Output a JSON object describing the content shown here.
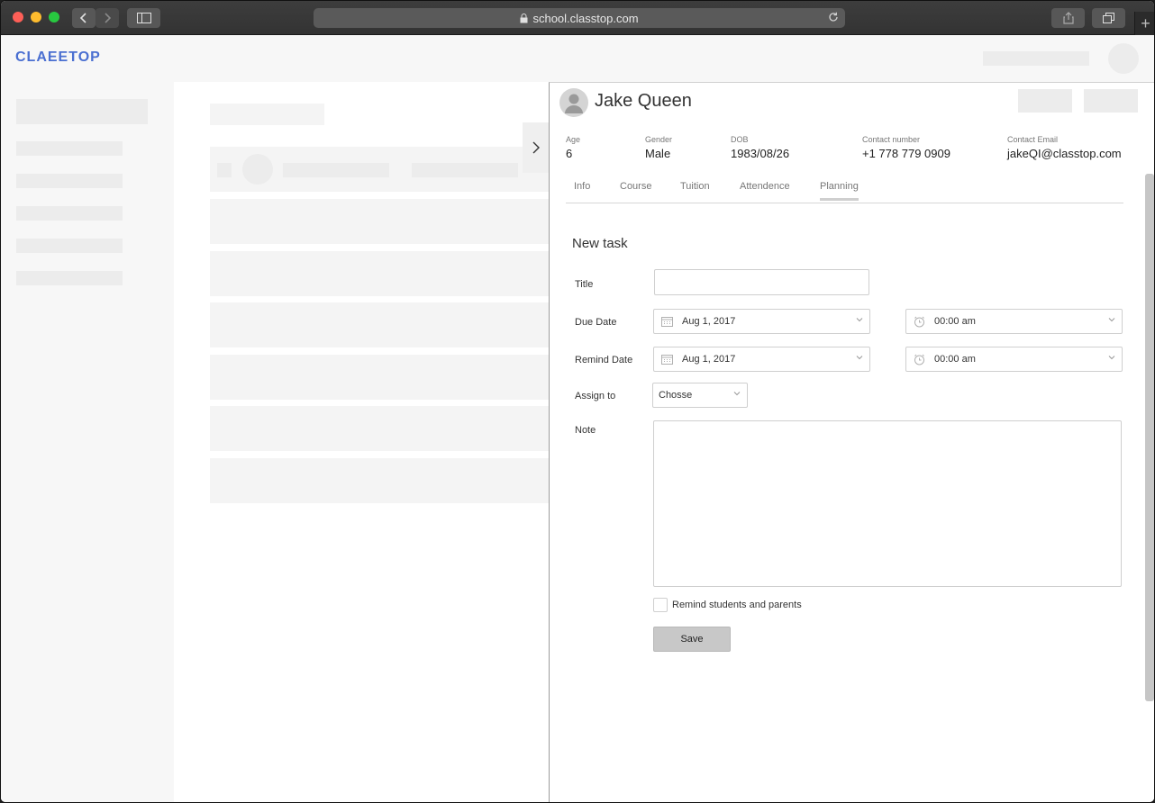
{
  "browser": {
    "url": "school.classtop.com"
  },
  "app": {
    "logo": "CLAEETOP"
  },
  "student": {
    "name": "Jake Queen",
    "fields": [
      {
        "label": "Age",
        "value": "6"
      },
      {
        "label": "Gender",
        "value": "Male"
      },
      {
        "label": "DOB",
        "value": "1983/08/26"
      },
      {
        "label": "Contact number",
        "value": "+1 778 779 0909"
      },
      {
        "label": "Contact Email",
        "value": "jakeQI@classtop.com"
      }
    ]
  },
  "tabs": [
    {
      "label": "Info",
      "active": false
    },
    {
      "label": "Course",
      "active": false
    },
    {
      "label": "Tuition",
      "active": false
    },
    {
      "label": "Attendence",
      "active": false
    },
    {
      "label": "Planning",
      "active": true
    }
  ],
  "form": {
    "title": "New task",
    "title_label": "Title",
    "title_value": "",
    "due_label": "Due Date",
    "due_date": "Aug 1, 2017",
    "due_time": "00:00 am",
    "remind_label": "Remind Date",
    "remind_date": "Aug 1, 2017",
    "remind_time": "00:00 am",
    "assign_label": "Assign to",
    "assign_value": "Chosse",
    "note_label": "Note",
    "note_value": "",
    "remind_checkbox_label": "Remind students and parents",
    "remind_checked": false,
    "save_label": "Save"
  },
  "icons": {
    "calendar": "calendar-icon",
    "clock": "clock-icon",
    "chevron": "chevron-down-icon",
    "lock": "lock-icon",
    "reload": "reload-icon"
  }
}
